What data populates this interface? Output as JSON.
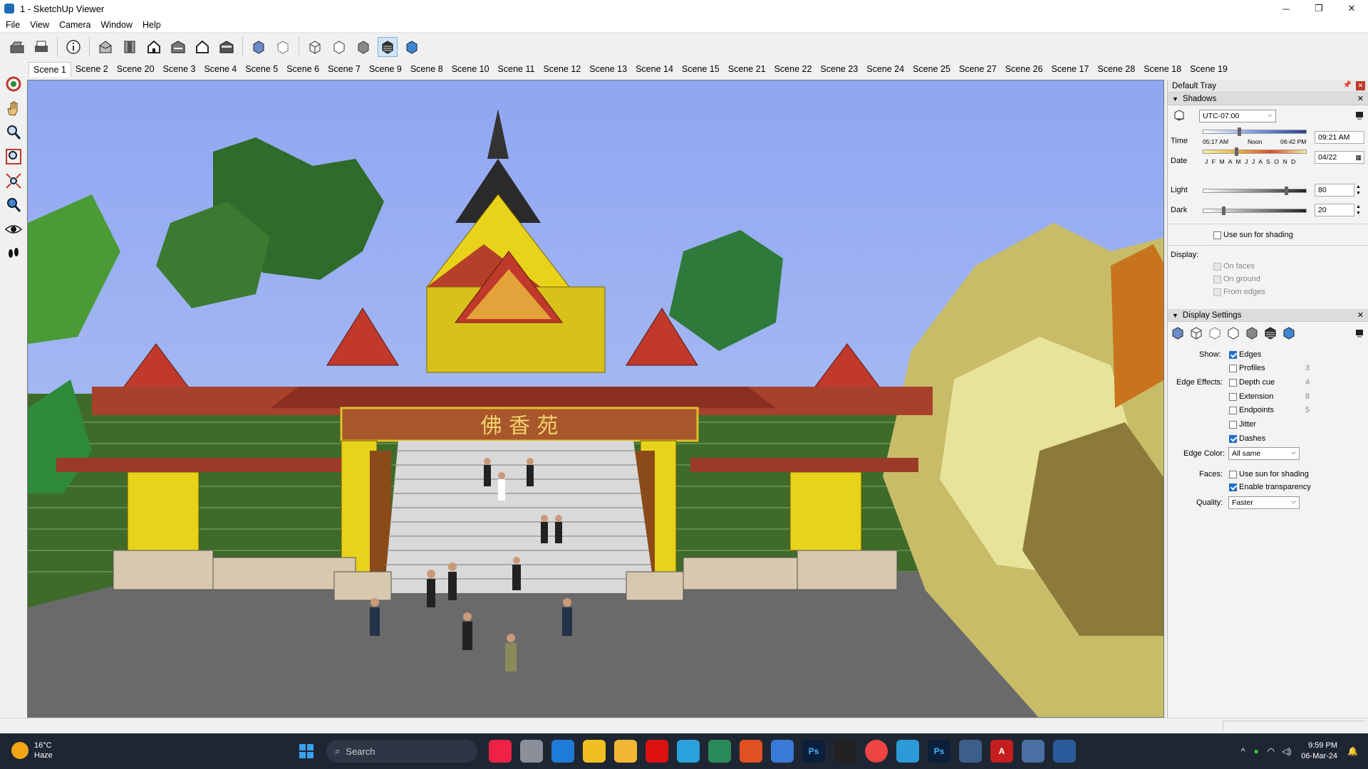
{
  "window": {
    "title": "1 - SketchUp Viewer",
    "minimize": "─",
    "maximize": "❐",
    "close": "✕"
  },
  "menu": [
    "File",
    "View",
    "Camera",
    "Window",
    "Help"
  ],
  "scenes": [
    "Scene 1",
    "Scene 2",
    "Scene 20",
    "Scene 3",
    "Scene 4",
    "Scene 5",
    "Scene 6",
    "Scene 7",
    "Scene 9",
    "Scene 8",
    "Scene 10",
    "Scene 11",
    "Scene 12",
    "Scene 13",
    "Scene 14",
    "Scene 15",
    "Scene 21",
    "Scene 22",
    "Scene 23",
    "Scene 24",
    "Scene 25",
    "Scene 27",
    "Scene 26",
    "Scene 17",
    "Scene 28",
    "Scene 18",
    "Scene 19"
  ],
  "selected_scene": "Scene 1",
  "viewport": {
    "sign_text": "佛 香 苑"
  },
  "tray": {
    "title": "Default Tray",
    "shadows": {
      "header": "Shadows",
      "timezone": "UTC-07:00",
      "time_label": "Time",
      "time_start": "05:17 AM",
      "time_noon": "Noon",
      "time_end": "06:42 PM",
      "time_value": "09:21 AM",
      "date_label": "Date",
      "months": "J F M A M J J A S O N D",
      "date_value": "04/22",
      "light_label": "Light",
      "light_value": "80",
      "light_level": 0.8,
      "dark_label": "Dark",
      "dark_value": "20",
      "dark_level": 0.2,
      "use_sun": "Use sun for shading",
      "display_label": "Display:",
      "on_faces": "On faces",
      "on_ground": "On ground",
      "from_edges": "From edges"
    },
    "display_settings": {
      "header": "Display Settings",
      "show_label": "Show:",
      "edges": "Edges",
      "profiles": "Profiles",
      "profiles_val": "3",
      "edge_effects_label": "Edge Effects:",
      "depth_cue": "Depth cue",
      "depth_cue_val": "4",
      "extension": "Extension",
      "extension_val": "8",
      "endpoints": "Endpoints",
      "endpoints_val": "5",
      "jitter": "Jitter",
      "dashes": "Dashes",
      "edge_color_label": "Edge Color:",
      "edge_color": "All same",
      "faces_label": "Faces:",
      "faces_use_sun": "Use sun for shading",
      "enable_transparency": "Enable transparency",
      "quality_label": "Quality:",
      "quality": "Faster"
    }
  },
  "taskbar": {
    "temp": "16°C",
    "condition": "Haze",
    "search": "Search",
    "time": "9:59 PM",
    "date": "06-Mar-24"
  }
}
